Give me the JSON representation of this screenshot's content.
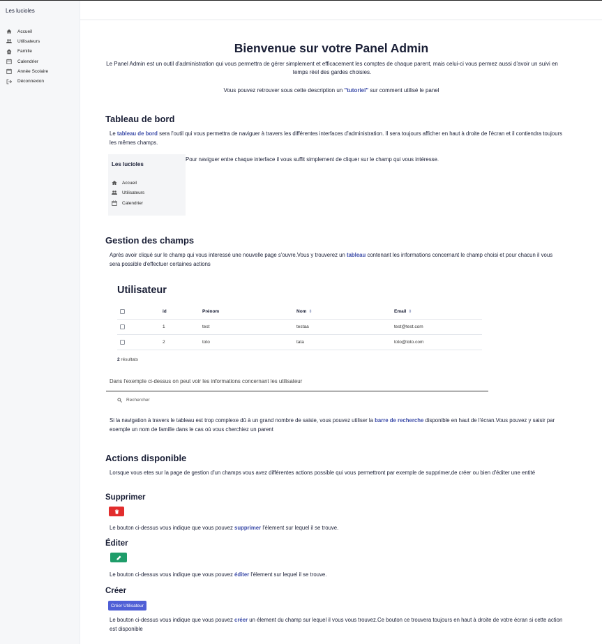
{
  "sidebar": {
    "brand": "Les lucioles",
    "items": [
      {
        "label": "Accueil",
        "icon": "home-icon"
      },
      {
        "label": "Utilisateurs",
        "icon": "users-icon"
      },
      {
        "label": "Famille",
        "icon": "family-icon"
      },
      {
        "label": "Calendrier",
        "icon": "calendar-icon"
      },
      {
        "label": "Année Scolaire",
        "icon": "calendar-icon"
      },
      {
        "label": "Déconnexion",
        "icon": "logout-icon"
      }
    ]
  },
  "page": {
    "title": "Bienvenue sur votre Panel Admin",
    "intro": "Le Panel Admin est un outil d'administration qui vous permettra de gérer simplement et efficacement les comptes de chaque parent, mais celui-ci vous permez aussi d'avoir un suivi en temps réel des gardes choisies.",
    "intro2_before": "Vous pouvez retrouver sous cette description un ",
    "intro2_link": "\"tutoriel\"",
    "intro2_after": " sur comment utilisé le panel"
  },
  "dashboard": {
    "heading": "Tableau de bord",
    "p1_before": "Le ",
    "p1_link": "tableau de bord",
    "p1_after": " sera l'outil qui vous permettra de naviguer à travers les différentes interfaces d'administration. Il sera toujours afficher en haut à droite de l'écran et il contiendra toujours les mêmes champs.",
    "p2": "Pour naviguer entre chaque interface il vous suffit simplement de cliquer sur le champ qui vous intéresse.",
    "mini_title": "Les lucioles",
    "mini_items": [
      "Accueil",
      "Utilisateurs",
      "Calendrier"
    ]
  },
  "fields": {
    "heading": "Gestion des champs",
    "p1_before": "Après avoir cliqué sur le champ qui vous interessé une nouvelle page s'ouvre.Vous y trouverez un ",
    "p1_link": "tableau",
    "p1_after": " contenant les informations concernant le champ choisi et pour chacun il vous sera possible d'effectuer certaines actions",
    "table_title": "Utilisateur",
    "columns": [
      "id",
      "Prénom",
      "Nom",
      "Email"
    ],
    "rows": [
      [
        "1",
        "test",
        "testaa",
        "test@test.com"
      ],
      [
        "2",
        "toto",
        "tata",
        "toto@toto.com"
      ]
    ],
    "count_num": "2",
    "count_label": " résultats",
    "caption": "Dans l'exemple ci-dessus on peut voir les informations concernant les utilisateur",
    "search_placeholder": "Rechercher",
    "p2_before": "Si la navigation à travers le tableau est trop complexe dû à un grand nombre de saisie, vous pouvez utiliser la ",
    "p2_link": "barre de recherche",
    "p2_after": " disponible en haut de l'écran.Vous pouvez y saisir par exemple un nom de famille dans le cas où vous cherchiez un parent"
  },
  "actions": {
    "heading": "Actions disponible",
    "p1": "Lorsque vous etes sur la page de gestion d'un champs vous avez différentes actions possible qui vous permettront par exemple de supprimer,de créer ou bien d'éditer une entité",
    "delete_heading": "Supprimer",
    "delete_before": "Le bouton ci-dessus vous indique que vous pouvez ",
    "delete_link": "supprimer",
    "delete_after": " l'élement sur lequel il se trouve.",
    "edit_heading": "Éditer",
    "edit_before": "Le bouton ci-dessus vous indique que vous pouvez ",
    "edit_link": "éditer",
    "edit_after": " l'élement sur lequel il se trouve.",
    "create_heading": "Créer",
    "create_button": "Créer Utilisateur",
    "create_before": "Le bouton ci-dessus vous indique que vous pouvez ",
    "create_link": "créer",
    "create_after": " un élement du champ sur lequel il vous vous trouvez.Ce bouton ce trouvera toujours en haut à droite de votre écran si cette action est disponible"
  },
  "colors": {
    "link": "#3b4ba8",
    "delete": "#e22d2d",
    "edit": "#1f9d6a",
    "create": "#4f5fd6"
  }
}
